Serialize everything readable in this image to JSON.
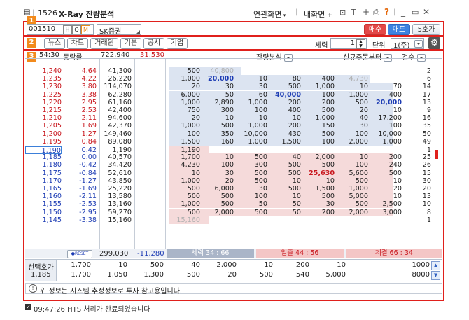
{
  "title": {
    "code": "1526",
    "name": "X-Ray 잔량분석",
    "links": [
      "연관화면",
      "내화면"
    ],
    "icons": [
      "menu-icon",
      "pin-icon",
      "text-size-icon",
      "plus-icon",
      "print-icon",
      "help-icon",
      "minimize-icon",
      "maximize-icon",
      "close-icon"
    ]
  },
  "toolbar1": {
    "badge": "1",
    "stock_code": "001510",
    "broker": "SK증권",
    "buy": "매수",
    "sell": "매도",
    "order": "5호가"
  },
  "toolbar2": {
    "badge": "2",
    "tabs": [
      "뉴스",
      "차트",
      "거래원",
      "기본",
      "공시",
      "기업"
    ],
    "strength_label": "세력",
    "strength_value": "1",
    "unit_label": "단위",
    "unit_value": "1(주)"
  },
  "grid_header": {
    "badge": "3",
    "time": "54:30",
    "rate": "등락률",
    "volume": "722,940",
    "volume_change": "31,530",
    "analysis": "잔량분석",
    "new_order": "신규주문부터",
    "count": "건수"
  },
  "ask_rows": [
    {
      "price": "1,240",
      "rate": "4.64",
      "qty": "41,300",
      "split": [
        "500",
        "40,800",
        "",
        "",
        "",
        "",
        ""
      ],
      "count": "2"
    },
    {
      "price": "1,235",
      "rate": "4.22",
      "qty": "26,220",
      "split": [
        "1,000",
        "20,000",
        "10",
        "80",
        "400",
        "4,730",
        ""
      ],
      "count": "6"
    },
    {
      "price": "1,230",
      "rate": "3.80",
      "qty": "114,070",
      "split": [
        "20",
        "30",
        "30",
        "500",
        "1,000",
        "10",
        "70"
      ],
      "count": "14"
    },
    {
      "price": "1,225",
      "rate": "3.38",
      "qty": "62,280",
      "split": [
        "6,000",
        "50",
        "60",
        "40,000",
        "100",
        "1,000",
        "400"
      ],
      "count": "17"
    },
    {
      "price": "1,220",
      "rate": "2.95",
      "qty": "61,160",
      "split": [
        "1,000",
        "2,890",
        "1,000",
        "200",
        "200",
        "500",
        "20,000"
      ],
      "count": "13"
    },
    {
      "price": "1,215",
      "rate": "2.53",
      "qty": "42,400",
      "split": [
        "750",
        "300",
        "100",
        "400",
        "500",
        "20",
        "10"
      ],
      "count": "9"
    },
    {
      "price": "1,210",
      "rate": "2.11",
      "qty": "94,600",
      "split": [
        "20",
        "10",
        "10",
        "10",
        "1,000",
        "40",
        "17,200"
      ],
      "count": "16"
    },
    {
      "price": "1,205",
      "rate": "1.69",
      "qty": "42,370",
      "split": [
        "1,000",
        "500",
        "1,000",
        "200",
        "150",
        "30",
        "100"
      ],
      "count": "35"
    },
    {
      "price": "1,200",
      "rate": "1.27",
      "qty": "149,460",
      "split": [
        "100",
        "350",
        "10,000",
        "430",
        "500",
        "100",
        "10,000"
      ],
      "count": "50"
    },
    {
      "price": "1,195",
      "rate": "0.84",
      "qty": "89,080",
      "split": [
        "1,500",
        "160",
        "1,000",
        "1,500",
        "100",
        "2,000",
        "1,000"
      ],
      "count": "49"
    }
  ],
  "bid_rows": [
    {
      "price": "1,190",
      "rate": "0.42",
      "qty": "1,190",
      "split": [
        "1,190",
        "",
        "",
        "",
        "",
        "",
        ""
      ],
      "count": "1"
    },
    {
      "price": "1,185",
      "rate": "0.00",
      "qty": "40,570",
      "split": [
        "1,700",
        "10",
        "500",
        "40",
        "2,000",
        "10",
        "200"
      ],
      "count": "25"
    },
    {
      "price": "1,180",
      "rate": "-0.42",
      "qty": "34,420",
      "split": [
        "4,230",
        "100",
        "300",
        "500",
        "500",
        "100",
        "240"
      ],
      "count": "26"
    },
    {
      "price": "1,175",
      "rate": "-0.84",
      "qty": "52,610",
      "split": [
        "10",
        "30",
        "500",
        "500",
        "25,630",
        "5,600",
        "500"
      ],
      "count": "15"
    },
    {
      "price": "1,170",
      "rate": "-1.27",
      "qty": "43,850",
      "split": [
        "1,000",
        "20",
        "500",
        "10",
        "10",
        "500",
        "10"
      ],
      "count": "30"
    },
    {
      "price": "1,165",
      "rate": "-1.69",
      "qty": "25,220",
      "split": [
        "500",
        "6,000",
        "30",
        "500",
        "1,500",
        "1,000",
        "20"
      ],
      "count": "20"
    },
    {
      "price": "1,160",
      "rate": "-2.11",
      "qty": "13,580",
      "split": [
        "500",
        "500",
        "100",
        "10",
        "500",
        "5,000",
        "10"
      ],
      "count": "13"
    },
    {
      "price": "1,155",
      "rate": "-2.53",
      "qty": "13,160",
      "split": [
        "1,000",
        "500",
        "50",
        "50",
        "30",
        "500",
        "2,500"
      ],
      "count": "10"
    },
    {
      "price": "1,150",
      "rate": "-2.95",
      "qty": "59,270",
      "split": [
        "500",
        "2,000",
        "500",
        "50",
        "200",
        "2,000",
        "3,000"
      ],
      "count": "8"
    },
    {
      "price": "1,145",
      "rate": "-3.38",
      "qty": "15,160",
      "split": [
        "15,160",
        "",
        "",
        "",
        "",
        "",
        ""
      ],
      "count": "1"
    }
  ],
  "footer_row": {
    "reset": "RESET",
    "total": "299,030",
    "change": "-11,280",
    "strength": "세력 34 : 66",
    "inflow": "입출 44 : 56",
    "trade": "체결 66 : 34"
  },
  "selected": {
    "label": "선택호가",
    "price": "1,185",
    "row1": [
      "1,700",
      "10",
      "500",
      "40",
      "2,000",
      "10",
      "200",
      "10",
      "1000"
    ],
    "row2": [
      "1,700",
      "1,050",
      "1,300",
      "500",
      "20",
      "500",
      "540",
      "5,000",
      "8000"
    ]
  },
  "notice": "위 정보는 시스템 추정정보로 투자 참고용입니다.",
  "status": "09:47:26 HTS 처리가 완료되었습니다",
  "colors": {
    "highlight": "#e0201c",
    "badge": "#f28a1c",
    "buy": "#e34848",
    "sell": "#3d82e0",
    "ask_text": "#c8161d",
    "bid_text": "#1d3cb4"
  }
}
